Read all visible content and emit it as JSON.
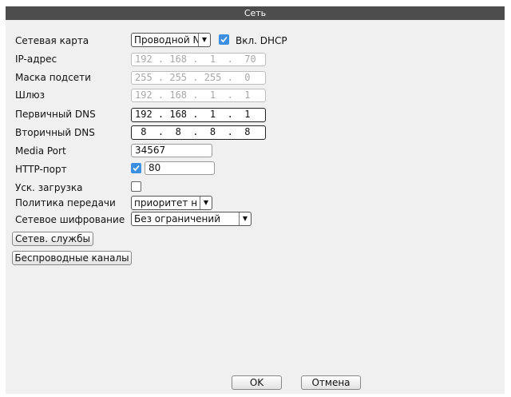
{
  "window": {
    "title": "Сеть"
  },
  "labels": {
    "network_card": "Сетевая карта",
    "ip": "IP-адрес",
    "mask": "Маска подсети",
    "gateway": "Шлюз",
    "dns1": "Первичный DNS",
    "dns2": "Вторичный DNS",
    "media_port": "Media Port",
    "http_port": "HTTP-порт",
    "fast_load": "Уск. загрузка",
    "transfer_policy": "Политика передачи",
    "encryption": "Сетевое шифрование"
  },
  "values": {
    "network_card": "Проводной N",
    "dhcp_label": "Вкл. DHCP",
    "dhcp_checked": true,
    "ip": "192 . 168 .  1  .  70",
    "mask": "255 . 255 . 255 .  0",
    "gateway": "192 . 168 .  1  .  1",
    "dns1": "192 . 168 .  1  .  1",
    "dns2": " 8  .  8  .  8  .  8",
    "media_port": "34567",
    "http_checked": true,
    "http_port": "80",
    "fast_load_checked": false,
    "transfer_policy": "приоритет н",
    "encryption": "Без ограничений"
  },
  "buttons": {
    "net_services": "Сетев. службы",
    "wireless": "Беспроводные каналы",
    "ok": "OK",
    "cancel": "Отмена"
  },
  "icons": {
    "dropdown": "▼",
    "check": "check-icon"
  },
  "colors": {
    "titlebar": "#4d4d4d",
    "checkbox": "#3c8ee0"
  }
}
